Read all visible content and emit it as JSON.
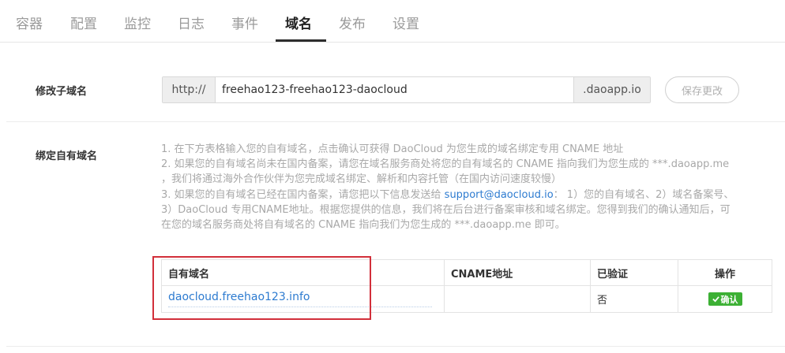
{
  "tabs": [
    {
      "label": "容器",
      "active": false
    },
    {
      "label": "配置",
      "active": false
    },
    {
      "label": "监控",
      "active": false
    },
    {
      "label": "日志",
      "active": false
    },
    {
      "label": "事件",
      "active": false
    },
    {
      "label": "域名",
      "active": true
    },
    {
      "label": "发布",
      "active": false
    },
    {
      "label": "设置",
      "active": false
    }
  ],
  "subdomain": {
    "label": "修改子域名",
    "prefix": "http://",
    "value": "freehao123-freehao123-daocloud",
    "suffix": ".daoapp.io",
    "save_label": "保存更改"
  },
  "custom_domain": {
    "label": "绑定自有域名",
    "instructions": {
      "line1": "1. 在下方表格输入您的自有域名，点击确认可获得 DaoCloud 为您生成的域名绑定专用 CNAME 地址",
      "line2": "2. 如果您的自有域名尚未在国内备案，请您在域名服务商处将您的自有域名的 CNAME 指向我们为您生成的 ***.daoapp.me",
      "line3": "，我们将通过海外合作伙伴为您完成域名绑定、解析和内容托管（在国内访问速度较慢）",
      "line4_before": "3. 如果您的自有域名已经在国内备案，请您把以下信息发送给 ",
      "line4_link": "support@daocloud.io",
      "line4_after": "： 1）您的自有域名、2）域名备案号、",
      "line5": "3）DaoCloud 专用CNAME地址。根据您提供的信息，我们将在后台进行备案审核和域名绑定。您得到我们的确认通知后，可",
      "line6": "在您的域名服务商处将自有域名的 CNAME 指向我们为您生成的 ***.daoapp.me 即可。"
    },
    "table": {
      "headers": {
        "domain": "自有域名",
        "cname": "CNAME地址",
        "verified": "已验证",
        "action": "操作"
      },
      "rows": [
        {
          "domain": "daocloud.freehao123.info",
          "cname": "",
          "verified": "否",
          "action_label": "确认"
        }
      ]
    }
  },
  "colors": {
    "link": "#2d7bd0",
    "confirm_button": "#3cb034",
    "highlight": "#d22f3a"
  }
}
